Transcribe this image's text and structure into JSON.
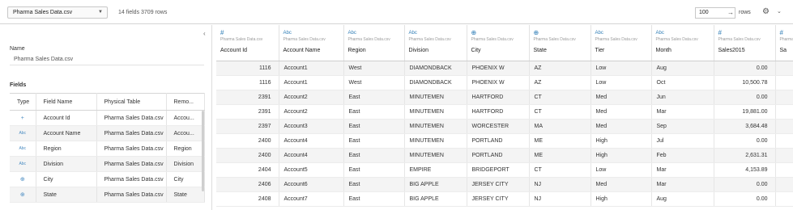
{
  "toolbar": {
    "source_name": "Pharma Sales Data.csv",
    "summary": "14 fields 3709 rows",
    "rows_value": "100",
    "rows_label": "rows"
  },
  "left_panel": {
    "name_label": "Name",
    "name_value": "Pharma Sales Data.csv",
    "fields_label": "Fields",
    "columns": [
      "Type",
      "Field Name",
      "Physical Table",
      "Remo..."
    ],
    "fields": [
      {
        "type_icon": "#",
        "name": "Account Id",
        "table": "Pharma Sales Data.csv",
        "remote": "Accou..."
      },
      {
        "type_icon": "Abc",
        "name": "Account Name",
        "table": "Pharma Sales Data.csv",
        "remote": "Accou..."
      },
      {
        "type_icon": "Abc",
        "name": "Region",
        "table": "Pharma Sales Data.csv",
        "remote": "Region"
      },
      {
        "type_icon": "Abc",
        "name": "Division",
        "table": "Pharma Sales Data.csv",
        "remote": "Division"
      },
      {
        "type_icon": "globe",
        "name": "City",
        "table": "Pharma Sales Data.csv",
        "remote": "City"
      },
      {
        "type_icon": "globe",
        "name": "State",
        "table": "Pharma Sales Data.csv",
        "remote": "State"
      }
    ]
  },
  "grid": {
    "columns": [
      {
        "icon": "#",
        "source": "Pharma Sales Data.csv",
        "name": "Account Id"
      },
      {
        "icon": "Abc",
        "source": "Pharma Sales Data.csv",
        "name": "Account Name"
      },
      {
        "icon": "Abc",
        "source": "Pharma Sales Data.csv",
        "name": "Region"
      },
      {
        "icon": "Abc",
        "source": "Pharma Sales Data.csv",
        "name": "Division"
      },
      {
        "icon": "globe",
        "source": "Pharma Sales Data.csv",
        "name": "City"
      },
      {
        "icon": "globe",
        "source": "Pharma Sales Data.csv",
        "name": "State"
      },
      {
        "icon": "Abc",
        "source": "Pharma Sales Data.csv",
        "name": "Tier"
      },
      {
        "icon": "Abc",
        "source": "Pharma Sales Data.csv",
        "name": "Month"
      },
      {
        "icon": "#",
        "source": "Pharma Sales Data.csv",
        "name": "Sales2015"
      },
      {
        "icon": "#",
        "source": "Pharma",
        "name": "Sa"
      }
    ],
    "rows": [
      [
        "1116",
        "Account1",
        "West",
        "DIAMONDBACK",
        "PHOENIX W",
        "AZ",
        "Low",
        "Aug",
        "0.00",
        ""
      ],
      [
        "1116",
        "Account1",
        "West",
        "DIAMONDBACK",
        "PHOENIX W",
        "AZ",
        "Low",
        "Oct",
        "10,500.78",
        ""
      ],
      [
        "2391",
        "Account2",
        "East",
        "MINUTEMEN",
        "HARTFORD",
        "CT",
        "Med",
        "Jun",
        "0.00",
        ""
      ],
      [
        "2391",
        "Account2",
        "East",
        "MINUTEMEN",
        "HARTFORD",
        "CT",
        "Med",
        "Mar",
        "19,881.00",
        ""
      ],
      [
        "2397",
        "Account3",
        "East",
        "MINUTEMEN",
        "WORCESTER",
        "MA",
        "Med",
        "Sep",
        "3,684.48",
        ""
      ],
      [
        "2400",
        "Account4",
        "East",
        "MINUTEMEN",
        "PORTLAND",
        "ME",
        "High",
        "Jul",
        "0.00",
        ""
      ],
      [
        "2400",
        "Account4",
        "East",
        "MINUTEMEN",
        "PORTLAND",
        "ME",
        "High",
        "Feb",
        "2,631.31",
        ""
      ],
      [
        "2404",
        "Account5",
        "East",
        "EMPIRE",
        "BRIDGEPORT",
        "CT",
        "Low",
        "Mar",
        "4,153.89",
        ""
      ],
      [
        "2406",
        "Account6",
        "East",
        "BIG APPLE",
        "JERSEY CITY",
        "NJ",
        "Med",
        "Mar",
        "0.00",
        ""
      ],
      [
        "2408",
        "Account7",
        "East",
        "BIG APPLE",
        "JERSEY CITY",
        "NJ",
        "High",
        "Aug",
        "0.00",
        ""
      ]
    ]
  }
}
